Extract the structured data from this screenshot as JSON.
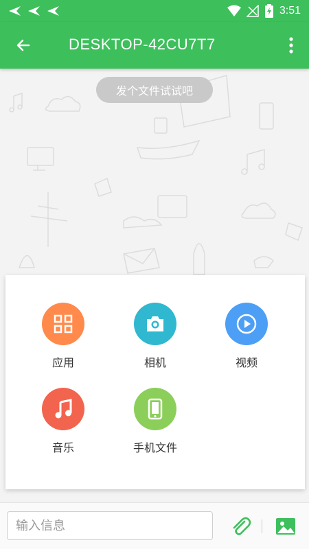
{
  "status_bar": {
    "time": "3:51"
  },
  "app_bar": {
    "title": "DESKTOP-42CU7T7"
  },
  "chat": {
    "hint": "发个文件试试吧"
  },
  "attach_panel": {
    "items": [
      {
        "label": "应用",
        "icon": "apps-grid-icon",
        "color": "#ff8a4c"
      },
      {
        "label": "相机",
        "icon": "camera-icon",
        "color": "#2fb8cf"
      },
      {
        "label": "视频",
        "icon": "play-icon",
        "color": "#4d9ef5"
      },
      {
        "label": "音乐",
        "icon": "music-note-icon",
        "color": "#f2644e"
      },
      {
        "label": "手机文件",
        "icon": "phone-icon",
        "color": "#8bcf5a"
      }
    ]
  },
  "input_bar": {
    "placeholder": "输入信息"
  },
  "colors": {
    "primary": "#3dbf5c"
  }
}
